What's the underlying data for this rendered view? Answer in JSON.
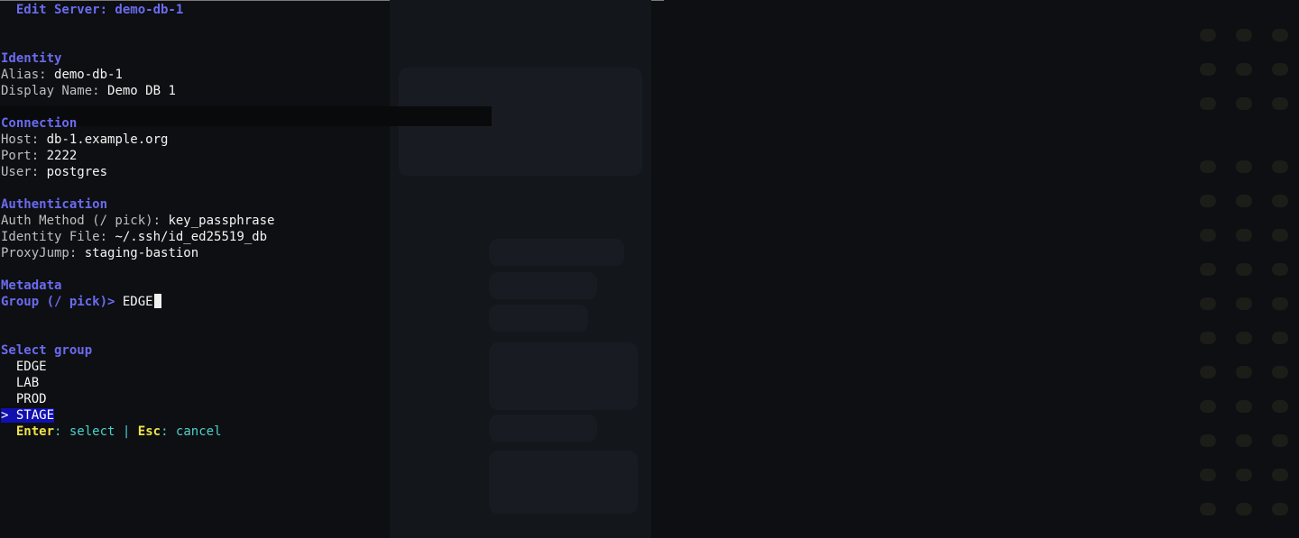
{
  "title": "Edit Server: demo-db-1",
  "identity": {
    "heading": "Identity",
    "alias_label": "Alias:",
    "alias": "demo-db-1",
    "display_label": "Display Name:",
    "display": "Demo DB 1"
  },
  "connection": {
    "heading": "Connection",
    "host_label": "Host:",
    "host": "db-1.example.org",
    "port_label": "Port:",
    "port": "2222",
    "user_label": "User:",
    "user": "postgres"
  },
  "authentication": {
    "heading": "Authentication",
    "method_label": "Auth Method (/ pick):",
    "method": "key_passphrase",
    "file_label": "Identity File:",
    "file": "~/.ssh/id_ed25519_db",
    "proxy_label": "ProxyJump:",
    "proxy": "staging-bastion"
  },
  "metadata": {
    "heading": "Metadata",
    "group_prompt": "Group (/ pick)>",
    "group_value": "EDGE"
  },
  "picker": {
    "heading": "Select group",
    "options": [
      "EDGE",
      "LAB",
      "PROD",
      "STAGE"
    ],
    "selected_marker": ">",
    "selected_index": 3
  },
  "footer": {
    "enter_key": "Enter",
    "enter_action": "select",
    "separator": "|",
    "esc_key": "Esc",
    "esc_action": "cancel"
  },
  "colors": {
    "background": "#0d0f12",
    "heading": "#6b6bf0",
    "selection": "#1010b0",
    "hotkey": "#f0e24a",
    "hint": "#4ed0c8"
  }
}
